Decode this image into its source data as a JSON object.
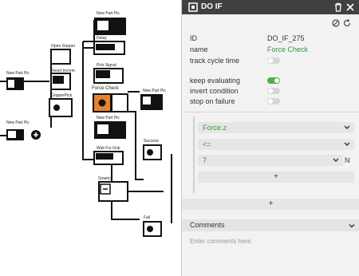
{
  "flow": {
    "nodes": [
      {
        "name": "node-new-part-pic-top",
        "label": "New Part Pic"
      },
      {
        "name": "node-delay",
        "label": "Delay"
      },
      {
        "name": "node-pick-signal",
        "label": "Pick Signal"
      },
      {
        "name": "node-force-check",
        "label": "Force Check"
      },
      {
        "name": "node-new-part-pic-right",
        "label": "New Part Pic"
      },
      {
        "name": "node-new-part-pic-mid",
        "label": "New Part Pic"
      },
      {
        "name": "node-wait-for-grip",
        "label": "Wait For Grip"
      },
      {
        "name": "node-smartc",
        "label": "Smartc"
      },
      {
        "name": "node-success",
        "label": "Success"
      },
      {
        "name": "node-fail",
        "label": "Fail"
      },
      {
        "name": "node-open-gripper",
        "label": "Open Gripper"
      },
      {
        "name": "node-reset-increm",
        "label": "Reset Increm"
      },
      {
        "name": "node-gripper-pick",
        "label": "GripperPick"
      },
      {
        "name": "node-new-part-pic-left",
        "label": "New Part Pic"
      },
      {
        "name": "node-new-part-pic-bottom-left",
        "label": "New Part Pic"
      }
    ],
    "close_symbol": "×"
  },
  "panel": {
    "title": "DO IF",
    "icons": {
      "header": "node-type-icon",
      "delete": "trash-icon",
      "close": "close-icon",
      "disable": "disable-icon",
      "refresh": "refresh-icon"
    },
    "id_label": "ID",
    "id_value": "DO_IF_275",
    "name_label": "name",
    "name_value": "Force Check",
    "track_cycle_time": {
      "label": "track cycle time",
      "on": false
    },
    "keep_evaluating": {
      "label": "keep evaluating",
      "on": true
    },
    "invert_condition": {
      "label": "invert condition",
      "on": false
    },
    "stop_on_failure": {
      "label": "stop on failure",
      "on": false
    },
    "condition": {
      "variable": "Force.z",
      "operator": "<=",
      "value": "7",
      "unit": "N",
      "add_label": "+"
    },
    "add_condition_label": "+",
    "comments_label": "Comments",
    "comments_placeholder": "Enter comments here."
  },
  "colors": {
    "accent_green": "#2e9a3a",
    "toggle_on": "#4caf50",
    "header_bg": "#404040",
    "selected_node": "#e8842a"
  }
}
